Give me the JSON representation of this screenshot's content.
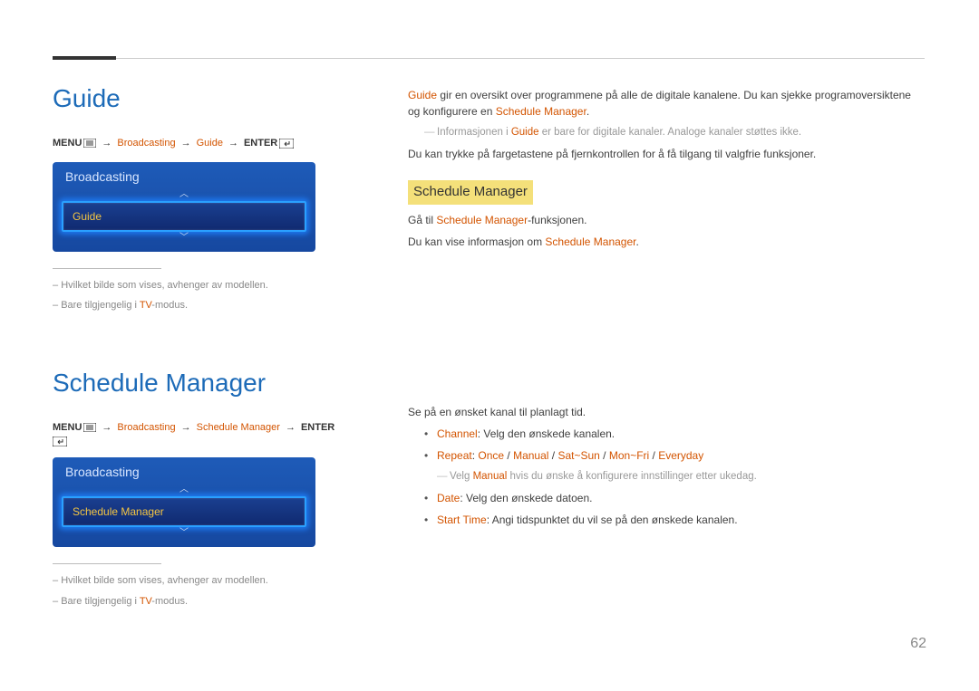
{
  "page_number": "62",
  "section1": {
    "title": "Guide",
    "menu_prefix": "MENU",
    "menu_path": [
      "Broadcasting",
      "Guide"
    ],
    "menu_suffix": "ENTER",
    "osd": {
      "title": "Broadcasting",
      "item": "Guide"
    },
    "notes": [
      {
        "pre": "Hvilket bilde som vises, avhenger av modellen.",
        "hl": "",
        "post": ""
      },
      {
        "pre": "Bare tilgjengelig i ",
        "hl": "TV",
        "post": "-modus."
      }
    ]
  },
  "section2": {
    "title": "Schedule Manager",
    "menu_prefix": "MENU",
    "menu_path": [
      "Broadcasting",
      "Schedule Manager"
    ],
    "menu_suffix": "ENTER",
    "osd": {
      "title": "Broadcasting",
      "item": "Schedule Manager"
    },
    "notes": [
      {
        "pre": "Hvilket bilde som vises, avhenger av modellen.",
        "hl": "",
        "post": ""
      },
      {
        "pre": "Bare tilgjengelig i ",
        "hl": "TV",
        "post": "-modus."
      }
    ]
  },
  "right": {
    "p1_a": "Guide",
    "p1_b": " gir en oversikt over programmene på alle de digitale kanalene. Du kan sjekke programoversiktene og konfigurere en ",
    "p1_c": "Schedule Manager",
    "p1_d": ".",
    "note1_a": "Informasjonen i ",
    "note1_b": "Guide",
    "note1_c": " er bare for digitale kanaler. Analoge kanaler støttes ikke.",
    "p2": "Du kan trykke på fargetastene på fjernkontrollen for å få tilgang til valgfrie funksjoner.",
    "hl": "Schedule Manager",
    "p3_a": "Gå til ",
    "p3_b": "Schedule Manager",
    "p3_c": "-funksjonen.",
    "p4_a": "Du kan vise informasjon om ",
    "p4_b": "Schedule Manager",
    "p4_c": ".",
    "p5": "Se på en ønsket kanal til planlagt tid.",
    "li1_a": "Channel",
    "li1_b": ": Velg den ønskede kanalen.",
    "li2_a": "Repeat",
    "li2_b": ": ",
    "li2_c": "Once",
    "li2_d": " / ",
    "li2_e": "Manual",
    "li2_f": " / ",
    "li2_g": "Sat~Sun",
    "li2_h": " / ",
    "li2_i": "Mon~Fri",
    "li2_j": " / ",
    "li2_k": "Everyday",
    "note2_a": "Velg ",
    "note2_b": "Manual",
    "note2_c": " hvis du ønske å konfigurere innstillinger etter ukedag.",
    "li3_a": "Date",
    "li3_b": ": Velg den ønskede datoen.",
    "li4_a": "Start Time",
    "li4_b": ": Angi tidspunktet du vil se på den ønskede kanalen."
  }
}
